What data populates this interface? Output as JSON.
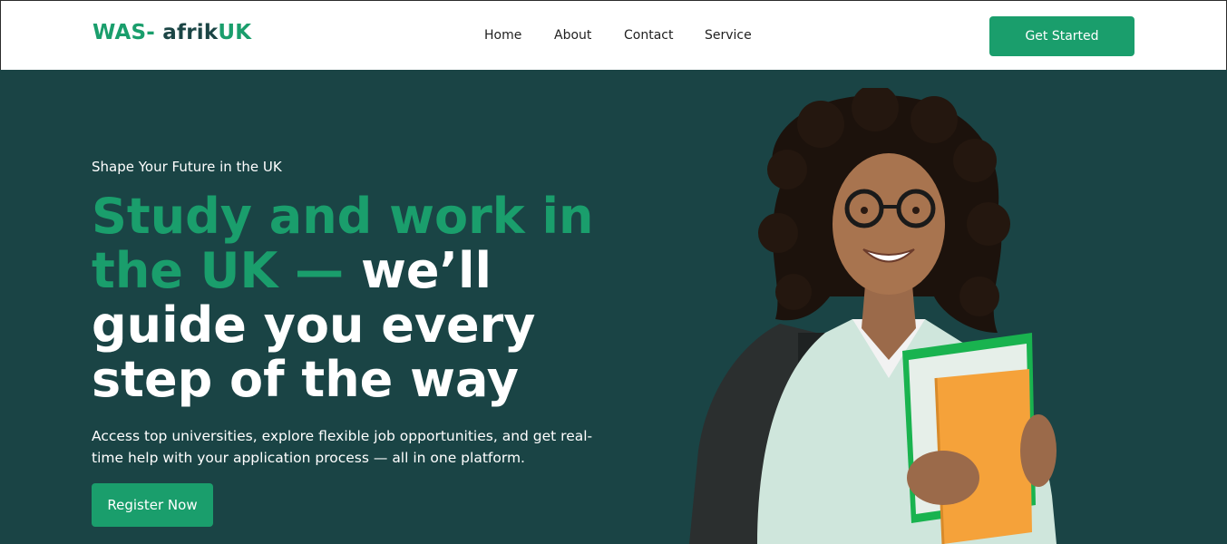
{
  "brand": {
    "prefix": "WAS- ",
    "middle": "afrik",
    "suffix": "UK"
  },
  "nav": {
    "items": [
      {
        "label": "Home"
      },
      {
        "label": "About"
      },
      {
        "label": "Contact"
      },
      {
        "label": "Service"
      }
    ],
    "cta_label": "Get Started"
  },
  "hero": {
    "eyebrow": "Shape Your Future in the UK",
    "headline_highlight": "Study and work in the UK —",
    "headline_rest": " we’ll guide you every step of the way",
    "description": "Access top universities, explore flexible job opportunities, and get real-time help with your application process — all in one platform.",
    "cta_label": "Register Now",
    "image": "student-with-backpack-and-folders"
  },
  "colors": {
    "accent": "#1a9e6c",
    "hero_bg": "#1a4445",
    "logo_dark": "#1b4545"
  }
}
